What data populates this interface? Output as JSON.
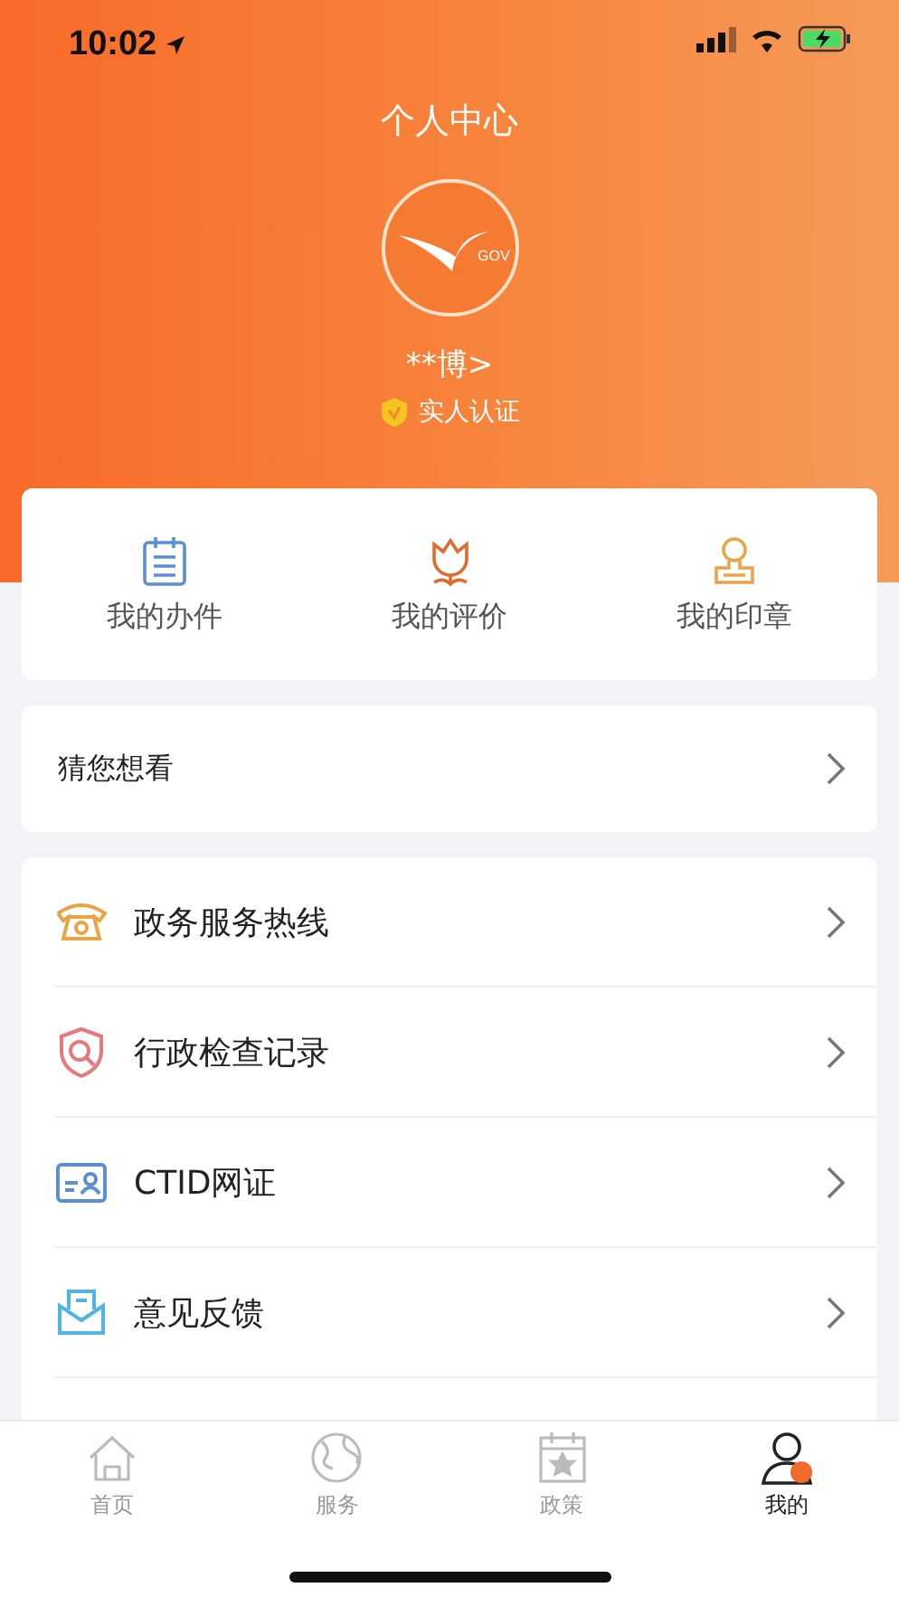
{
  "status_bar": {
    "time": "10:02"
  },
  "header": {
    "title": "个人中心",
    "logo_text": "GOV",
    "user_name": "**博>",
    "verification": "实人认证"
  },
  "quick_actions": [
    {
      "kind": "tasks",
      "label": "我的办件"
    },
    {
      "kind": "rating",
      "label": "我的评价"
    },
    {
      "kind": "seal",
      "label": "我的印章"
    }
  ],
  "guess": {
    "label": "猜您想看"
  },
  "menu": [
    {
      "kind": "hotline",
      "label": "政务服务热线"
    },
    {
      "kind": "inspection",
      "label": "行政检查记录"
    },
    {
      "kind": "ctid",
      "label": "CTID网证"
    },
    {
      "kind": "feedback",
      "label": "意见反馈"
    }
  ],
  "tab_bar": [
    {
      "kind": "home",
      "label": "首页",
      "selected": false
    },
    {
      "kind": "service",
      "label": "服务",
      "selected": false
    },
    {
      "kind": "policy",
      "label": "政策",
      "selected": false
    },
    {
      "kind": "mine",
      "label": "我的",
      "selected": true
    }
  ]
}
